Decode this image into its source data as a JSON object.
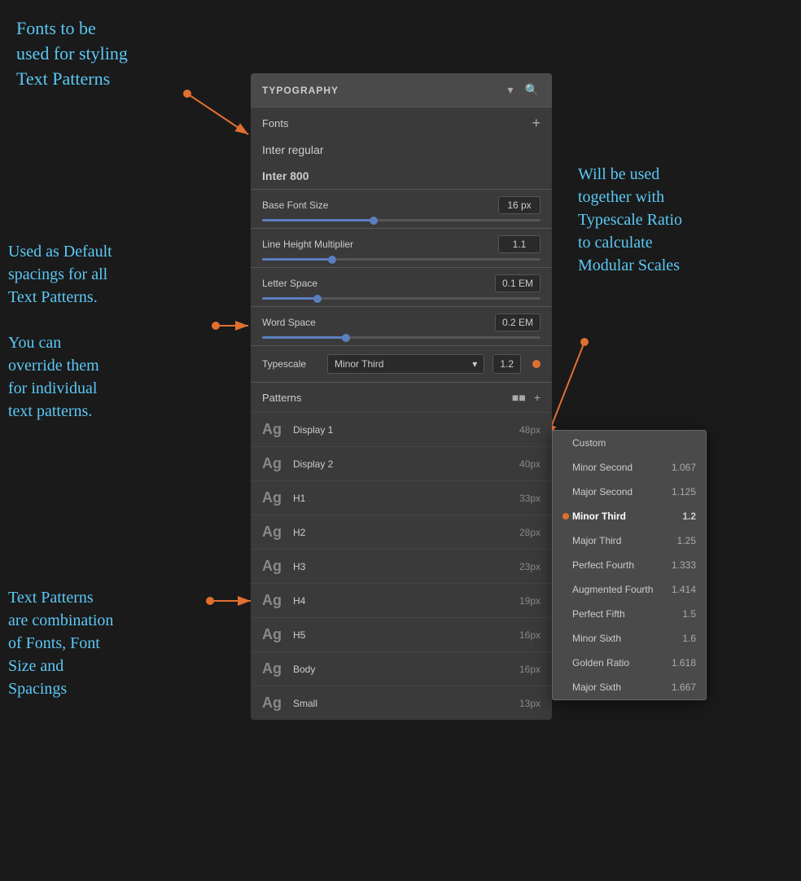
{
  "annotations": {
    "top_left": "Fonts to be\nused for styling\nText Patterns",
    "mid_left": "Used as Default\nspacings for all\nText Patterns.\n\nYou can\noverride them\nfor individual\ntext patterns.",
    "bottom_left": "Text Patterns\nare combination\nof Fonts, Font\nSize and\nSpacings",
    "top_right": "Will be used\ntogether with\nTypescale Ratio\nto calculate\nModular Scales"
  },
  "panel": {
    "header": {
      "title": "TYPOGRAPHY",
      "chevron": "▾",
      "search": "🔍"
    },
    "fonts_section": {
      "title": "Fonts",
      "add_label": "+",
      "items": [
        {
          "name": "Inter regular",
          "bold": false
        },
        {
          "name": "Inter 800",
          "bold": true
        }
      ]
    },
    "base_font": {
      "label": "Base Font Size",
      "value": "16 px",
      "slider_percent": 40
    },
    "line_height": {
      "label": "Line Height Multiplier",
      "value": "1.1",
      "slider_percent": 25
    },
    "letter_space": {
      "label": "Letter Space",
      "value": "0.1 EM",
      "slider_percent": 20
    },
    "word_space": {
      "label": "Word Space",
      "value": "0.2 EM",
      "slider_percent": 30
    },
    "typescale": {
      "label": "Typescale",
      "selected_name": "Minor Third",
      "selected_value": "1.2"
    },
    "patterns_section": {
      "title": "Patterns",
      "items": [
        {
          "ag": "Ag",
          "name": "Display 1",
          "size": "48px"
        },
        {
          "ag": "Ag",
          "name": "Display 2",
          "size": "40px"
        },
        {
          "ag": "Ag",
          "name": "H1",
          "size": "33px"
        },
        {
          "ag": "Ag",
          "name": "H2",
          "size": "28px"
        },
        {
          "ag": "Ag",
          "name": "H3",
          "size": "23px"
        },
        {
          "ag": "Ag",
          "name": "H4",
          "size": "19px"
        },
        {
          "ag": "Ag",
          "name": "H5",
          "size": "16px"
        },
        {
          "ag": "Ag",
          "name": "Body",
          "size": "16px"
        },
        {
          "ag": "Ag",
          "name": "Small",
          "size": "13px"
        }
      ]
    }
  },
  "dropdown": {
    "items": [
      {
        "name": "Custom",
        "value": "",
        "active": false
      },
      {
        "name": "Minor Second",
        "value": "1.067",
        "active": false
      },
      {
        "name": "Major Second",
        "value": "1.125",
        "active": false
      },
      {
        "name": "Minor Third",
        "value": "1.2",
        "active": true
      },
      {
        "name": "Major Third",
        "value": "1.25",
        "active": false
      },
      {
        "name": "Perfect Fourth",
        "value": "1.333",
        "active": false
      },
      {
        "name": "Augmented Fourth",
        "value": "1.414",
        "active": false
      },
      {
        "name": "Perfect Fifth",
        "value": "1.5",
        "active": false
      },
      {
        "name": "Minor Sixth",
        "value": "1.6",
        "active": false
      },
      {
        "name": "Golden Ratio",
        "value": "1.618",
        "active": false
      },
      {
        "name": "Major Sixth",
        "value": "1.667",
        "active": false
      }
    ]
  },
  "colors": {
    "orange": "#e07030",
    "blue_text": "#5bc8f5",
    "slider_blue": "#5b7fbe"
  }
}
